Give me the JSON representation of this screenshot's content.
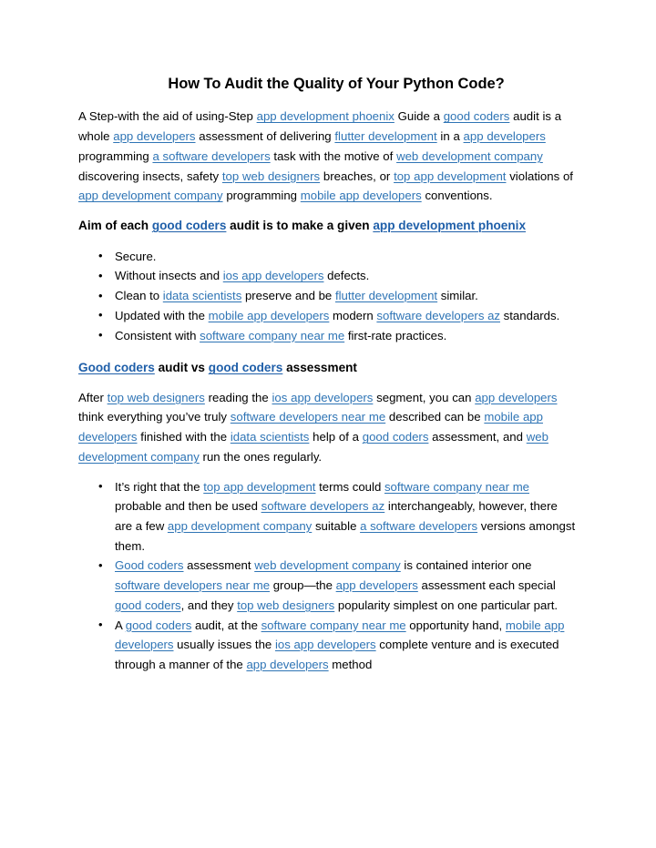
{
  "document": {
    "title": "How To Audit the Quality of Your Python Code?",
    "link_color": "#2E74B5",
    "heading_link_color": "#1F5FA9",
    "text_color": "#000000",
    "background_color": "#FFFFFF"
  },
  "intro_paragraph": {
    "name": "intro-paragraph",
    "tokens": [
      {
        "t": "A Step-with the aid of using-Step "
      },
      {
        "t": "app development phoenix",
        "link": true
      },
      {
        "t": " Guide a "
      },
      {
        "t": "good coders",
        "link": true
      },
      {
        "t": " audit is a whole "
      },
      {
        "t": "app developers",
        "link": true
      },
      {
        "t": " assessment of delivering "
      },
      {
        "t": "flutter development",
        "link": true
      },
      {
        "t": " in a "
      },
      {
        "t": "app developers",
        "link": true
      },
      {
        "t": " programming "
      },
      {
        "t": "a software developers",
        "link": true
      },
      {
        "t": " task with the motive of "
      },
      {
        "t": "web development company",
        "link": true
      },
      {
        "t": " discovering insects, safety "
      },
      {
        "t": "top web designers",
        "link": true
      },
      {
        "t": " breaches, or "
      },
      {
        "t": "top app development",
        "link": true
      },
      {
        "t": " violations of "
      },
      {
        "t": "app development company",
        "link": true
      },
      {
        "t": " programming "
      },
      {
        "t": "mobile app developers",
        "link": true
      },
      {
        "t": " conventions."
      }
    ]
  },
  "aim_heading": {
    "name": "aim-heading",
    "tokens": [
      {
        "t": "Aim of each "
      },
      {
        "t": "good coders",
        "link": true
      },
      {
        "t": " audit is to make a given "
      },
      {
        "t": "app development phoenix",
        "link": true
      }
    ]
  },
  "aim_bullets": [
    {
      "name": "bullet-secure",
      "tokens": [
        {
          "t": "Secure."
        }
      ]
    },
    {
      "name": "bullet-without-insects",
      "tokens": [
        {
          "t": "Without insects and "
        },
        {
          "t": "ios app developers",
          "link": true
        },
        {
          "t": " defects."
        }
      ]
    },
    {
      "name": "bullet-clean-to-preserve",
      "tokens": [
        {
          "t": "Clean to "
        },
        {
          "t": "idata scientists",
          "link": true
        },
        {
          "t": " preserve and be "
        },
        {
          "t": "flutter development",
          "link": true
        },
        {
          "t": " similar."
        }
      ]
    },
    {
      "name": "bullet-updated-standards",
      "tokens": [
        {
          "t": "Updated with the "
        },
        {
          "t": "mobile app developers",
          "link": true
        },
        {
          "t": " modern "
        },
        {
          "t": "software developers az",
          "link": true
        },
        {
          "t": " standards."
        }
      ]
    },
    {
      "name": "bullet-consistent-practices",
      "tokens": [
        {
          "t": "Consistent with "
        },
        {
          "t": "software company near me",
          "link": true
        },
        {
          "t": " first-rate practices."
        }
      ]
    }
  ],
  "audit_vs_heading": {
    "name": "audit-vs-assessment-heading",
    "tokens": [
      {
        "t": "Good coders",
        "link": true
      },
      {
        "t": " audit vs "
      },
      {
        "t": "good coders",
        "link": true
      },
      {
        "t": " assessment"
      }
    ]
  },
  "audit_vs_paragraph": {
    "name": "audit-vs-paragraph",
    "tokens": [
      {
        "t": "After "
      },
      {
        "t": "top web designers",
        "link": true
      },
      {
        "t": " reading the "
      },
      {
        "t": "ios app developers",
        "link": true
      },
      {
        "t": " segment, you can "
      },
      {
        "t": "app developers",
        "link": true
      },
      {
        "t": " think everything you’ve truly "
      },
      {
        "t": "software developers near me",
        "link": true
      },
      {
        "t": " described can be "
      },
      {
        "t": "mobile app developers",
        "link": true
      },
      {
        "t": " finished with the "
      },
      {
        "t": "idata scientists",
        "link": true
      },
      {
        "t": " help of a "
      },
      {
        "t": "good coders",
        "link": true
      },
      {
        "t": " assessment, and "
      },
      {
        "t": "web development company",
        "link": true
      },
      {
        "t": " run the ones regularly."
      }
    ]
  },
  "audit_vs_bullets": [
    {
      "name": "bullet-terms-interchangeable",
      "tokens": [
        {
          "t": "It’s right that the "
        },
        {
          "t": "top app development",
          "link": true
        },
        {
          "t": " terms could "
        },
        {
          "t": "software company near me",
          "link": true
        },
        {
          "t": " probable and then be used "
        },
        {
          "t": "software developers az",
          "link": true
        },
        {
          "t": " interchangeably, however, there are a few "
        },
        {
          "t": "app development company",
          "link": true
        },
        {
          "t": " suitable "
        },
        {
          "t": "a software developers",
          "link": true
        },
        {
          "t": " versions amongst them."
        }
      ]
    },
    {
      "name": "bullet-assessment-contained-interior",
      "tokens": [
        {
          "t": "Good coders",
          "link": true
        },
        {
          "t": " assessment "
        },
        {
          "t": "web development company",
          "link": true
        },
        {
          "t": " is contained interior one "
        },
        {
          "t": "software developers near me",
          "link": true
        },
        {
          "t": " group—the "
        },
        {
          "t": "app developers",
          "link": true
        },
        {
          "t": " assessment each special "
        },
        {
          "t": "good coders",
          "link": true
        },
        {
          "t": ", and they "
        },
        {
          "t": "top web designers",
          "link": true
        },
        {
          "t": " popularity simplest on one particular part."
        }
      ]
    },
    {
      "name": "bullet-audit-opportunity-hand",
      "tokens": [
        {
          "t": "A "
        },
        {
          "t": "good coders",
          "link": true
        },
        {
          "t": " audit, at the "
        },
        {
          "t": "software company near me",
          "link": true
        },
        {
          "t": " opportunity hand, "
        },
        {
          "t": "mobile app developers",
          "link": true
        },
        {
          "t": " usually issues the "
        },
        {
          "t": "ios app developers",
          "link": true
        },
        {
          "t": " complete venture and is executed through a manner of the "
        },
        {
          "t": "app developers",
          "link": true
        },
        {
          "t": " method"
        }
      ]
    }
  ]
}
